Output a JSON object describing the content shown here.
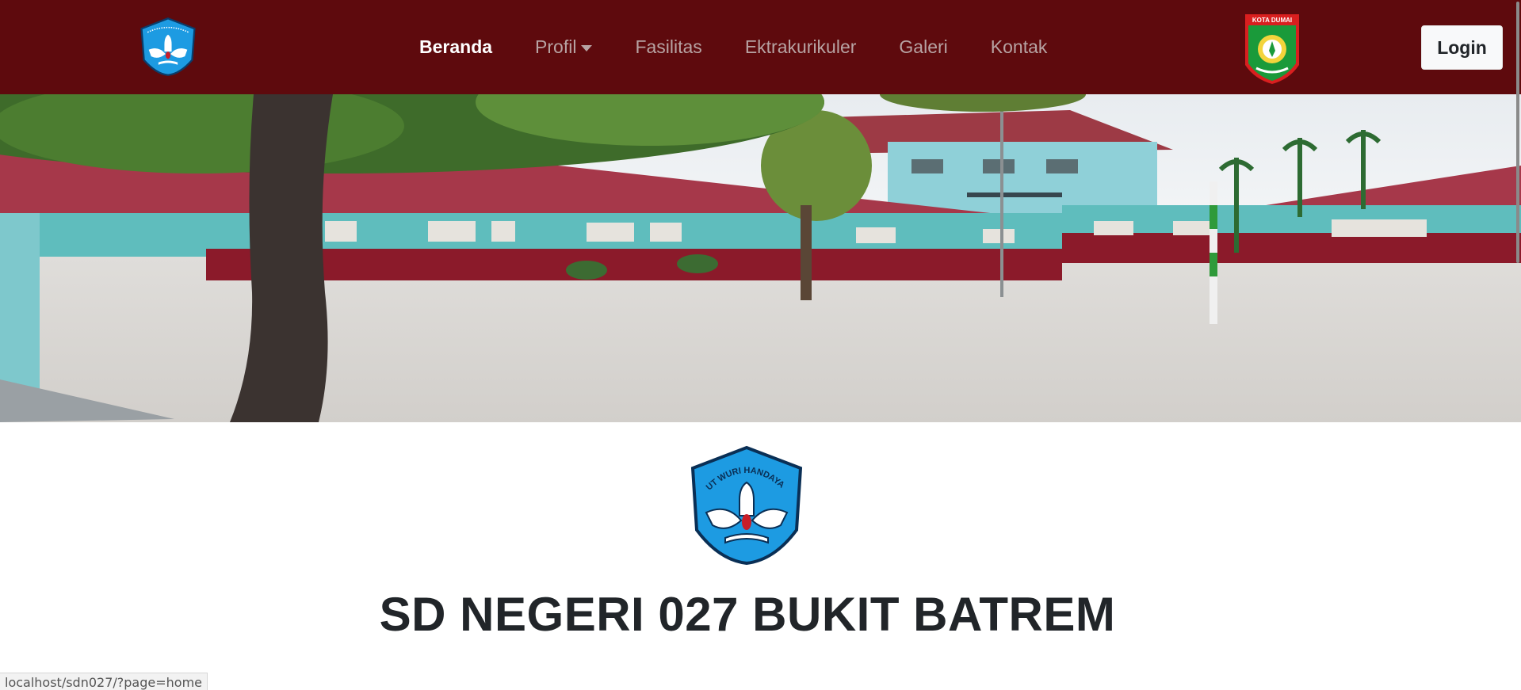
{
  "navbar": {
    "logo_left": "tut-wuri-handayani-logo",
    "links": [
      {
        "label": "Beranda",
        "active": true
      },
      {
        "label": "Profil",
        "dropdown": true
      },
      {
        "label": "Fasilitas"
      },
      {
        "label": "Ektrakurikuler"
      },
      {
        "label": "Galeri"
      },
      {
        "label": "Kontak"
      }
    ],
    "logo_right_text": "KOTA DUMAI",
    "login_label": "Login"
  },
  "hero": {
    "image": "school-courtyard-photo"
  },
  "main": {
    "emblem_text": "TUT WURI HANDAYANI",
    "title": "SD NEGERI 027 BUKIT BATREM"
  },
  "status_bar": {
    "url": "localhost/sdn027/?page=home"
  },
  "colors": {
    "navbar_bg": "#5e0a0d",
    "nav_active": "#ffffff",
    "nav_inactive": "#b7a3a3",
    "title": "#212529",
    "emblem_blue": "#1d9be2"
  }
}
